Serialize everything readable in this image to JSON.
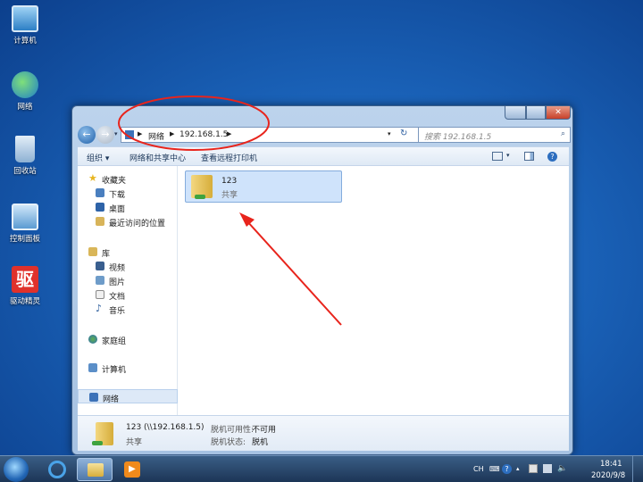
{
  "desktop": {
    "icons": [
      {
        "label": "计算机",
        "icon": "computer-icon"
      },
      {
        "label": "网络",
        "icon": "network-icon"
      },
      {
        "label": "回收站",
        "icon": "recycle-bin-icon"
      },
      {
        "label": "控制面板",
        "icon": "control-panel-icon"
      },
      {
        "label": "驱动精灵",
        "icon": "driver-genius-icon"
      }
    ],
    "driver_icon_char": "驱"
  },
  "window": {
    "address": {
      "root": "网络",
      "host": "192.168.1.5"
    },
    "search_placeholder": "搜索 192.168.1.5",
    "toolbar": {
      "organize": "组织",
      "network_center": "网络和共享中心",
      "remote_printers": "查看远程打印机"
    },
    "nav": {
      "favorites": "收藏夹",
      "downloads": "下载",
      "desktop": "桌面",
      "recent": "最近访问的位置",
      "libraries": "库",
      "videos": "视频",
      "pictures": "图片",
      "documents": "文档",
      "music": "音乐",
      "homegroup": "家庭组",
      "computer": "计算机",
      "network": "网络"
    },
    "content": {
      "item_name": "123",
      "item_type": "共享"
    },
    "details": {
      "name": "123 (\\\\192.168.1.5)",
      "type": "共享",
      "availability_label": "脱机可用性:",
      "availability_value": "不可用",
      "status_label": "脱机状态:",
      "status_value": "脱机"
    }
  },
  "taskbar": {
    "lang": "CH",
    "time": "18:41",
    "date": "2020/9/8"
  },
  "colors": {
    "annotation": "#e8241c",
    "selection": "#cfe3fb",
    "window_frame": "#a6c2e2"
  }
}
